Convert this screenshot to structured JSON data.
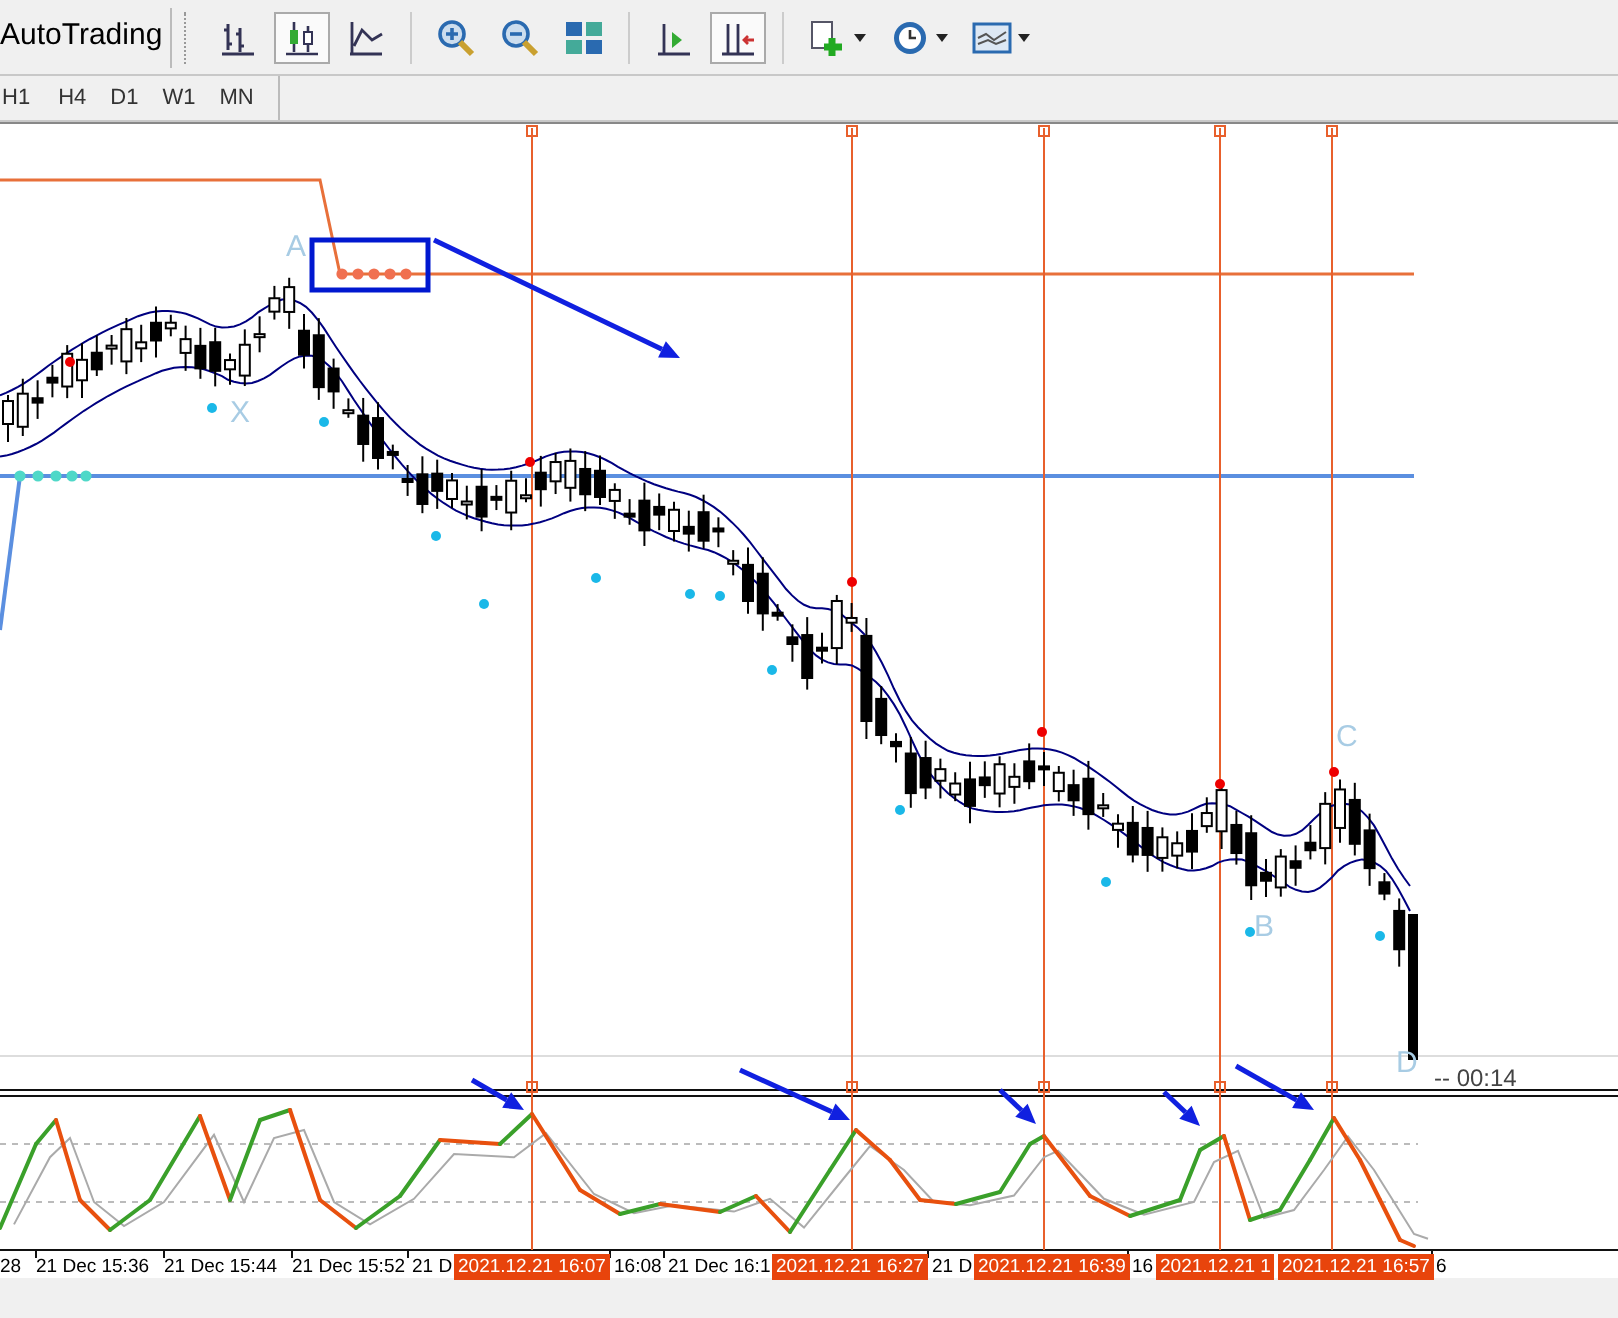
{
  "toolbar": {
    "autotrading": "AutoTrading",
    "buttons": [
      {
        "kind": "bars",
        "pressed": false
      },
      {
        "kind": "candles",
        "pressed": true
      },
      {
        "kind": "line",
        "pressed": false
      },
      {
        "kind": "zoom-in",
        "pressed": false
      },
      {
        "kind": "zoom-out",
        "pressed": false
      },
      {
        "kind": "tile",
        "pressed": false
      },
      {
        "kind": "shift",
        "pressed": false
      },
      {
        "kind": "autoscroll",
        "pressed": true
      },
      {
        "kind": "indicators",
        "pressed": false
      },
      {
        "kind": "periods",
        "pressed": false
      },
      {
        "kind": "templates",
        "pressed": false
      }
    ]
  },
  "timeframes": [
    "H1",
    "H4",
    "D1",
    "W1",
    "MN"
  ],
  "chart": {
    "pattern_labels": [
      "A",
      "X",
      "B",
      "C",
      "D"
    ],
    "countdown": "-- 00:14"
  },
  "time_axis": [
    {
      "text": "28",
      "kind": "time"
    },
    {
      "text": "21 Dec 15:36",
      "kind": "time"
    },
    {
      "text": "21 Dec 15:44",
      "kind": "time"
    },
    {
      "text": "21 Dec 15:52",
      "kind": "time"
    },
    {
      "text": "21 D",
      "kind": "time"
    },
    {
      "text": "2021.12.21 16:07",
      "kind": "marker"
    },
    {
      "text": "16:08",
      "kind": "time"
    },
    {
      "text": "21 Dec 16:1",
      "kind": "time"
    },
    {
      "text": "2021.12.21 16:27",
      "kind": "marker"
    },
    {
      "text": "21 D",
      "kind": "time"
    },
    {
      "text": "2021.12.21 16:39",
      "kind": "marker"
    },
    {
      "text": "16",
      "kind": "time"
    },
    {
      "text": "2021.12.21 1",
      "kind": "marker"
    },
    {
      "text": "2021.12.21 16:57",
      "kind": "marker"
    },
    {
      "text": "6",
      "kind": "time"
    }
  ]
}
